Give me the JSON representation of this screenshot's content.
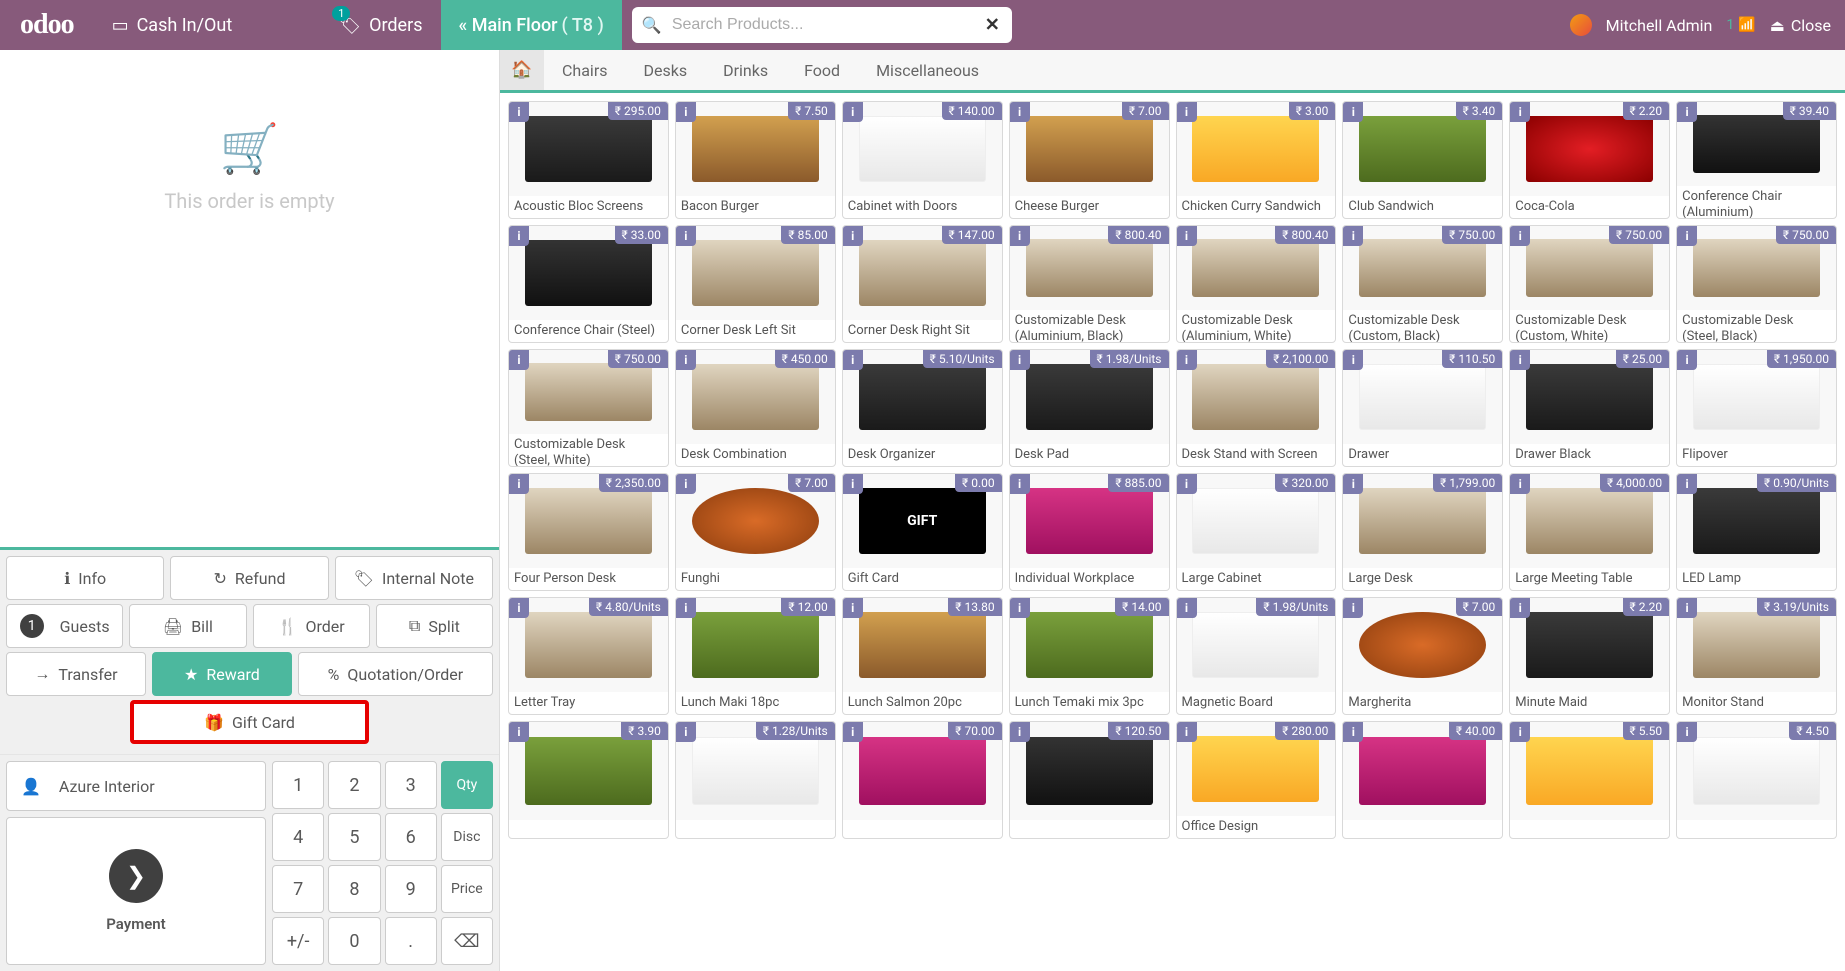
{
  "topbar": {
    "logo": "odoo",
    "cash": "Cash In/Out",
    "orders": "Orders",
    "orders_badge": "1",
    "floor_prefix": "« Main Floor",
    "floor_table": "( T8 )",
    "search_placeholder": "Search Products...",
    "user": "Mitchell Admin",
    "wifi_count": "1",
    "close": "Close"
  },
  "order": {
    "empty_text": "This order is empty"
  },
  "actions": {
    "info": "Info",
    "refund": "Refund",
    "note": "Internal Note",
    "guests": "Guests",
    "guests_count": "1",
    "bill": "Bill",
    "order": "Order",
    "split": "Split",
    "transfer": "Transfer",
    "reward": "Reward",
    "quotation": "Quotation/Order",
    "giftcard": "Gift Card"
  },
  "customer": "Azure Interior",
  "payment": "Payment",
  "numpad": {
    "qty": "Qty",
    "disc": "Disc",
    "price": "Price",
    "k1": "1",
    "k2": "2",
    "k3": "3",
    "k4": "4",
    "k5": "5",
    "k6": "6",
    "k7": "7",
    "k8": "8",
    "k9": "9",
    "k0": "0",
    "plusminus": "+/-",
    "dot": ".",
    "back": "⌫"
  },
  "categories": [
    "Chairs",
    "Desks",
    "Drinks",
    "Food",
    "Miscellaneous"
  ],
  "products": [
    {
      "name": "Acoustic Bloc Screens",
      "price": "₹ 295.00",
      "thumb": "thumb-dark"
    },
    {
      "name": "Bacon Burger",
      "price": "₹ 7.50",
      "thumb": "thumb-burger"
    },
    {
      "name": "Cabinet with Doors",
      "price": "₹ 140.00",
      "thumb": "thumb-white"
    },
    {
      "name": "Cheese Burger",
      "price": "₹ 7.00",
      "thumb": "thumb-burger"
    },
    {
      "name": "Chicken Curry Sandwich",
      "price": "₹ 3.00",
      "thumb": "thumb-yellow"
    },
    {
      "name": "Club Sandwich",
      "price": "₹ 3.40",
      "thumb": "thumb-green"
    },
    {
      "name": "Coca-Cola",
      "price": "₹ 2.20",
      "thumb": "thumb-drink"
    },
    {
      "name": "Conference Chair (Aluminium)",
      "price": "₹ 39.40",
      "thumb": "thumb-chair"
    },
    {
      "name": "Conference Chair (Steel)",
      "price": "₹ 33.00",
      "thumb": "thumb-chair"
    },
    {
      "name": "Corner Desk Left Sit",
      "price": "₹ 85.00",
      "thumb": "thumb-desk"
    },
    {
      "name": "Corner Desk Right Sit",
      "price": "₹ 147.00",
      "thumb": "thumb-desk"
    },
    {
      "name": "Customizable Desk (Aluminium, Black)",
      "price": "₹ 800.40",
      "thumb": "thumb-desk"
    },
    {
      "name": "Customizable Desk (Aluminium, White)",
      "price": "₹ 800.40",
      "thumb": "thumb-desk"
    },
    {
      "name": "Customizable Desk (Custom, Black)",
      "price": "₹ 750.00",
      "thumb": "thumb-desk"
    },
    {
      "name": "Customizable Desk (Custom, White)",
      "price": "₹ 750.00",
      "thumb": "thumb-desk"
    },
    {
      "name": "Customizable Desk (Steel, Black)",
      "price": "₹ 750.00",
      "thumb": "thumb-desk"
    },
    {
      "name": "Customizable Desk (Steel, White)",
      "price": "₹ 750.00",
      "thumb": "thumb-desk"
    },
    {
      "name": "Desk Combination",
      "price": "₹ 450.00",
      "thumb": "thumb-desk"
    },
    {
      "name": "Desk Organizer",
      "price": "₹ 5.10/Units",
      "thumb": "thumb-dark"
    },
    {
      "name": "Desk Pad",
      "price": "₹ 1.98/Units",
      "thumb": "thumb-dark"
    },
    {
      "name": "Desk Stand with Screen",
      "price": "₹ 2,100.00",
      "thumb": "thumb-desk"
    },
    {
      "name": "Drawer",
      "price": "₹ 110.50",
      "thumb": "thumb-white"
    },
    {
      "name": "Drawer Black",
      "price": "₹ 25.00",
      "thumb": "thumb-dark"
    },
    {
      "name": "Flipover",
      "price": "₹ 1,950.00",
      "thumb": "thumb-white"
    },
    {
      "name": "Four Person Desk",
      "price": "₹ 2,350.00",
      "thumb": "thumb-desk"
    },
    {
      "name": "Funghi",
      "price": "₹ 7.00",
      "thumb": "thumb-pizza"
    },
    {
      "name": "Gift Card",
      "price": "₹ 0.00",
      "thumb": "thumb-gift"
    },
    {
      "name": "Individual Workplace",
      "price": "₹ 885.00",
      "thumb": "thumb-pink"
    },
    {
      "name": "Large Cabinet",
      "price": "₹ 320.00",
      "thumb": "thumb-white"
    },
    {
      "name": "Large Desk",
      "price": "₹ 1,799.00",
      "thumb": "thumb-desk"
    },
    {
      "name": "Large Meeting Table",
      "price": "₹ 4,000.00",
      "thumb": "thumb-desk"
    },
    {
      "name": "LED Lamp",
      "price": "₹ 0.90/Units",
      "thumb": "thumb-dark"
    },
    {
      "name": "Letter Tray",
      "price": "₹ 4.80/Units",
      "thumb": "thumb-desk"
    },
    {
      "name": "Lunch Maki 18pc",
      "price": "₹ 12.00",
      "thumb": "thumb-green"
    },
    {
      "name": "Lunch Salmon 20pc",
      "price": "₹ 13.80",
      "thumb": "thumb-burger"
    },
    {
      "name": "Lunch Temaki mix 3pc",
      "price": "₹ 14.00",
      "thumb": "thumb-green"
    },
    {
      "name": "Magnetic Board",
      "price": "₹ 1.98/Units",
      "thumb": "thumb-white"
    },
    {
      "name": "Margherita",
      "price": "₹ 7.00",
      "thumb": "thumb-pizza"
    },
    {
      "name": "Minute Maid",
      "price": "₹ 2.20",
      "thumb": "thumb-dark"
    },
    {
      "name": "Monitor Stand",
      "price": "₹ 3.19/Units",
      "thumb": "thumb-desk"
    },
    {
      "name": "",
      "price": "₹ 3.90",
      "thumb": "thumb-green"
    },
    {
      "name": "",
      "price": "₹ 1.28/Units",
      "thumb": "thumb-white"
    },
    {
      "name": "",
      "price": "₹ 70.00",
      "thumb": "thumb-pink"
    },
    {
      "name": "",
      "price": "₹ 120.50",
      "thumb": "thumb-chair"
    },
    {
      "name": "Office Design",
      "price": "₹ 280.00",
      "thumb": "thumb-yellow"
    },
    {
      "name": "",
      "price": "₹ 40.00",
      "thumb": "thumb-pink"
    },
    {
      "name": "",
      "price": "₹ 5.50",
      "thumb": "thumb-yellow"
    },
    {
      "name": "",
      "price": "₹ 4.50",
      "thumb": "thumb-white"
    }
  ]
}
